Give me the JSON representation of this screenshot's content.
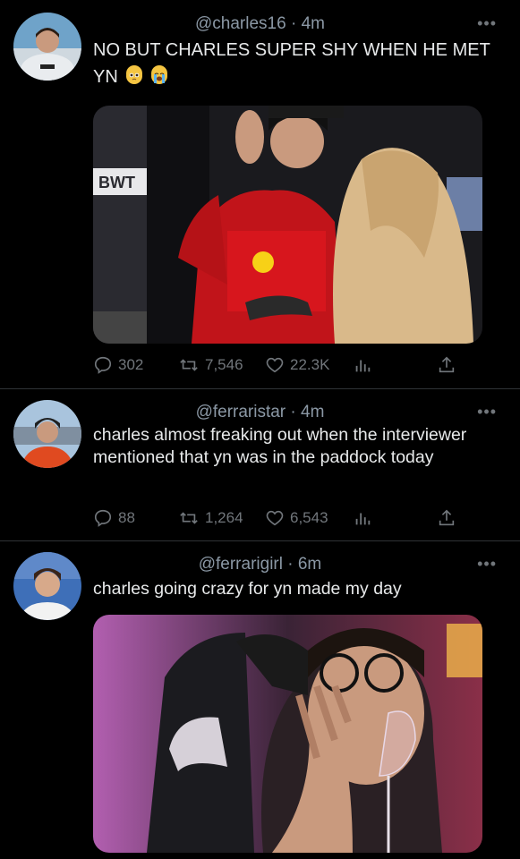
{
  "tweets": [
    {
      "handle": "@charles16",
      "time": "4m",
      "text": "NO BUT CHARLES SUPER SHY WHEN HE MET YN",
      "emojis": [
        "pleading-face",
        "loudly-crying-face"
      ],
      "media_text": "BWT",
      "stats": {
        "replies": "302",
        "retweets": "7,546",
        "likes": "22.3K"
      }
    },
    {
      "handle": "@ferraristar",
      "time": "4m",
      "text": "charles almost freaking out when the interviewer mentioned that yn was in the paddock today",
      "stats": {
        "replies": "88",
        "retweets": "1,264",
        "likes": "6,543"
      }
    },
    {
      "handle": "@ferrarigirl",
      "time": "6m",
      "text": "charles going crazy for yn made my day"
    }
  ],
  "colors": {
    "background": "#000000",
    "muted": "#71767b",
    "text": "#e7e9ea",
    "divider": "#2f3336"
  },
  "icons": [
    "reply-icon",
    "retweet-icon",
    "like-icon",
    "analytics-icon",
    "share-icon",
    "more-icon"
  ]
}
